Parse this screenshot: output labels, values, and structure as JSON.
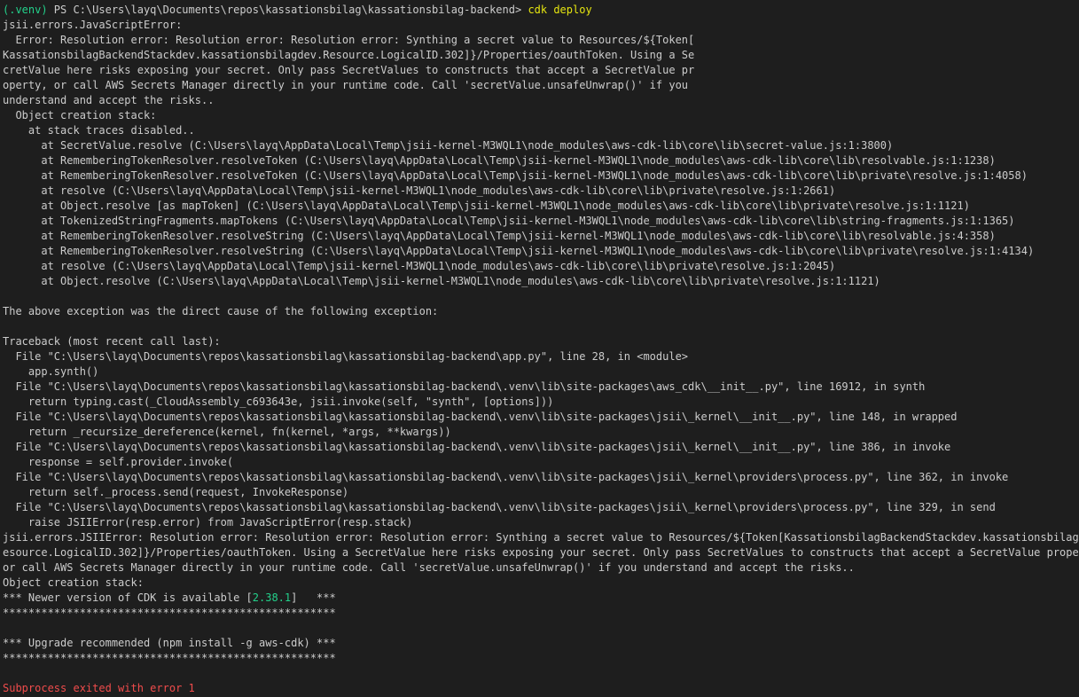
{
  "prompt": {
    "venv": "(.venv)",
    "path": " PS C:\\Users\\layq\\Documents\\repos\\kassationsbilag\\kassationsbilag-backend> ",
    "command": "cdk deploy"
  },
  "output": [
    "jsii.errors.JavaScriptError:",
    "  Error: Resolution error: Resolution error: Resolution error: Synthing a secret value to Resources/${Token[",
    "KassationsbilagBackendStackdev.kassationsbilagdev.Resource.LogicalID.302]}/Properties/oauthToken. Using a Se",
    "cretValue here risks exposing your secret. Only pass SecretValues to constructs that accept a SecretValue pr",
    "operty, or call AWS Secrets Manager directly in your runtime code. Call 'secretValue.unsafeUnwrap()' if you",
    "understand and accept the risks..",
    "  Object creation stack:",
    "    at stack traces disabled..",
    "      at SecretValue.resolve (C:\\Users\\layq\\AppData\\Local\\Temp\\jsii-kernel-M3WQL1\\node_modules\\aws-cdk-lib\\core\\lib\\secret-value.js:1:3800)",
    "      at RememberingTokenResolver.resolveToken (C:\\Users\\layq\\AppData\\Local\\Temp\\jsii-kernel-M3WQL1\\node_modules\\aws-cdk-lib\\core\\lib\\resolvable.js:1:1238)",
    "      at RememberingTokenResolver.resolveToken (C:\\Users\\layq\\AppData\\Local\\Temp\\jsii-kernel-M3WQL1\\node_modules\\aws-cdk-lib\\core\\lib\\private\\resolve.js:1:4058)",
    "      at resolve (C:\\Users\\layq\\AppData\\Local\\Temp\\jsii-kernel-M3WQL1\\node_modules\\aws-cdk-lib\\core\\lib\\private\\resolve.js:1:2661)",
    "      at Object.resolve [as mapToken] (C:\\Users\\layq\\AppData\\Local\\Temp\\jsii-kernel-M3WQL1\\node_modules\\aws-cdk-lib\\core\\lib\\private\\resolve.js:1:1121)",
    "      at TokenizedStringFragments.mapTokens (C:\\Users\\layq\\AppData\\Local\\Temp\\jsii-kernel-M3WQL1\\node_modules\\aws-cdk-lib\\core\\lib\\string-fragments.js:1:1365)",
    "      at RememberingTokenResolver.resolveString (C:\\Users\\layq\\AppData\\Local\\Temp\\jsii-kernel-M3WQL1\\node_modules\\aws-cdk-lib\\core\\lib\\resolvable.js:4:358)",
    "      at RememberingTokenResolver.resolveString (C:\\Users\\layq\\AppData\\Local\\Temp\\jsii-kernel-M3WQL1\\node_modules\\aws-cdk-lib\\core\\lib\\private\\resolve.js:1:4134)",
    "      at resolve (C:\\Users\\layq\\AppData\\Local\\Temp\\jsii-kernel-M3WQL1\\node_modules\\aws-cdk-lib\\core\\lib\\private\\resolve.js:1:2045)",
    "      at Object.resolve (C:\\Users\\layq\\AppData\\Local\\Temp\\jsii-kernel-M3WQL1\\node_modules\\aws-cdk-lib\\core\\lib\\private\\resolve.js:1:1121)",
    "",
    "The above exception was the direct cause of the following exception:",
    "",
    "Traceback (most recent call last):",
    "  File \"C:\\Users\\layq\\Documents\\repos\\kassationsbilag\\kassationsbilag-backend\\app.py\", line 28, in <module>",
    "    app.synth()",
    "  File \"C:\\Users\\layq\\Documents\\repos\\kassationsbilag\\kassationsbilag-backend\\.venv\\lib\\site-packages\\aws_cdk\\__init__.py\", line 16912, in synth",
    "    return typing.cast(_CloudAssembly_c693643e, jsii.invoke(self, \"synth\", [options]))",
    "  File \"C:\\Users\\layq\\Documents\\repos\\kassationsbilag\\kassationsbilag-backend\\.venv\\lib\\site-packages\\jsii\\_kernel\\__init__.py\", line 148, in wrapped",
    "    return _recursize_dereference(kernel, fn(kernel, *args, **kwargs))",
    "  File \"C:\\Users\\layq\\Documents\\repos\\kassationsbilag\\kassationsbilag-backend\\.venv\\lib\\site-packages\\jsii\\_kernel\\__init__.py\", line 386, in invoke",
    "    response = self.provider.invoke(",
    "  File \"C:\\Users\\layq\\Documents\\repos\\kassationsbilag\\kassationsbilag-backend\\.venv\\lib\\site-packages\\jsii\\_kernel\\providers\\process.py\", line 362, in invoke",
    "    return self._process.send(request, InvokeResponse)",
    "  File \"C:\\Users\\layq\\Documents\\repos\\kassationsbilag\\kassationsbilag-backend\\.venv\\lib\\site-packages\\jsii\\_kernel\\providers\\process.py\", line 329, in send",
    "    raise JSIIError(resp.error) from JavaScriptError(resp.stack)",
    "jsii.errors.JSIIError: Resolution error: Resolution error: Resolution error: Synthing a secret value to Resources/${Token[KassationsbilagBackendStackdev.kassationsbilagdev.R",
    "esource.LogicalID.302]}/Properties/oauthToken. Using a SecretValue here risks exposing your secret. Only pass SecretValues to constructs that accept a SecretValue property,",
    "or call AWS Secrets Manager directly in your runtime code. Call 'secretValue.unsafeUnwrap()' if you understand and accept the risks..",
    "Object creation stack:",
    "  at stack traces disabled..",
    "****************************************************",
    "",
    "*** Upgrade recommended (npm install -g aws-cdk) ***",
    "****************************************************",
    ""
  ],
  "version_notice": {
    "before": "*** Newer version of CDK is available [",
    "version": "2.38.1",
    "after": "]   ***"
  },
  "exit_message": "Subprocess exited with error 1",
  "colors": {
    "background": "#1e1e1e",
    "text": "#cccccc",
    "venv": "#23d18b",
    "command": "#e5e510",
    "version": "#23d18b",
    "error": "#f14c4c"
  }
}
